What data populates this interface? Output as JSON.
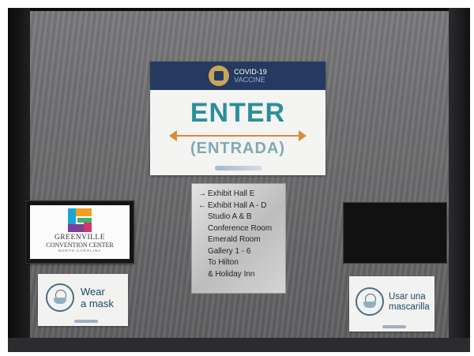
{
  "enter_sign": {
    "banner_line1": "COVID-19",
    "banner_line2": "VACCINE",
    "main": "ENTER",
    "sub": "(ENTRADA)",
    "icon": "vaccine-shield-icon",
    "accent_color": "#2a8f9a",
    "arrow_color": "#d98a3a"
  },
  "directory": {
    "items": [
      {
        "arrow": "→",
        "label": "Exhibit Hall E"
      },
      {
        "arrow": "←",
        "label": "Exhibit Hall A - D"
      },
      {
        "arrow": "",
        "label": "Studio A & B"
      },
      {
        "arrow": "",
        "label": "Conference Room"
      },
      {
        "arrow": "",
        "label": "Emerald Room"
      },
      {
        "arrow": "",
        "label": "Gallery 1 - 6"
      },
      {
        "arrow": "",
        "label": "To Hilton"
      },
      {
        "arrow": "",
        "label": "& Holiday Inn"
      }
    ]
  },
  "screen": {
    "name": "GREENVILLE",
    "subtitle": "CONVENTION CENTER",
    "state": "NORTH CAROLINA"
  },
  "mask_left": {
    "line1": "Wear",
    "line2": "a mask",
    "icon": "face-mask-icon"
  },
  "mask_right": {
    "line1": "Usar una",
    "line2": "mascarilla",
    "icon": "face-mask-icon"
  }
}
